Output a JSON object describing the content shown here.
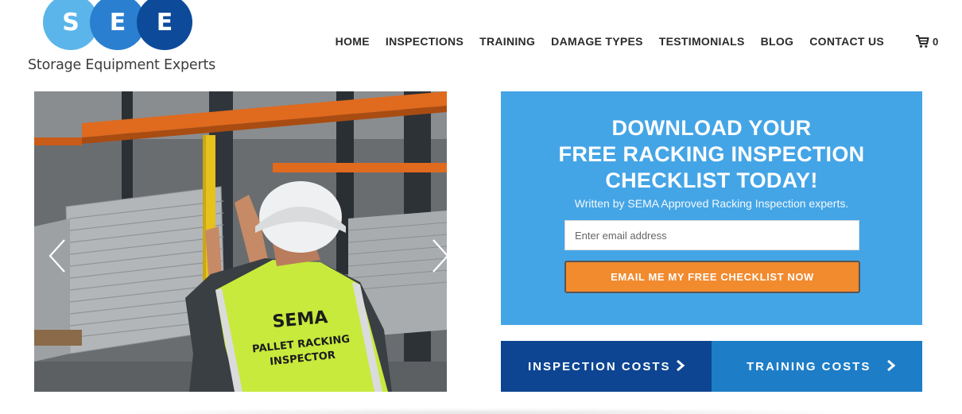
{
  "logo": {
    "letters": [
      "S",
      "E",
      "E"
    ],
    "tagline": "Storage Equipment Experts"
  },
  "nav": {
    "items": [
      "HOME",
      "INSPECTIONS",
      "TRAINING",
      "DAMAGE TYPES",
      "TESTIMONIALS",
      "BLOG",
      "CONTACT US"
    ],
    "cart_count": "0",
    "cart_icon": "cart-icon"
  },
  "slider": {
    "vest_lines": [
      "SEMA",
      "PALLET RACKING",
      "INSPECTOR"
    ],
    "prev_icon": "chevron-left-icon",
    "next_icon": "chevron-right-icon"
  },
  "optin": {
    "heading_lines": [
      "DOWNLOAD YOUR",
      "FREE RACKING INSPECTION",
      "CHECKLIST TODAY!"
    ],
    "subheading": "Written by SEMA Approved Racking Inspection experts.",
    "email_value": "",
    "email_placeholder": "Enter email address",
    "submit_label": "EMAIL ME MY FREE CHECKLIST NOW"
  },
  "cost_buttons": {
    "inspection_label": "INSPECTION COSTS",
    "training_label": "TRAINING COSTS",
    "icon": "chevron-right-icon"
  },
  "colors": {
    "optin_bg": "#44a5e6",
    "submit_bg": "#f28a2e",
    "inspection_bg": "#0d4592",
    "training_bg": "#1d7dc7",
    "logo_light": "#5bb5ea",
    "logo_mid": "#2a7fd0",
    "logo_dark": "#0d4a9a"
  }
}
